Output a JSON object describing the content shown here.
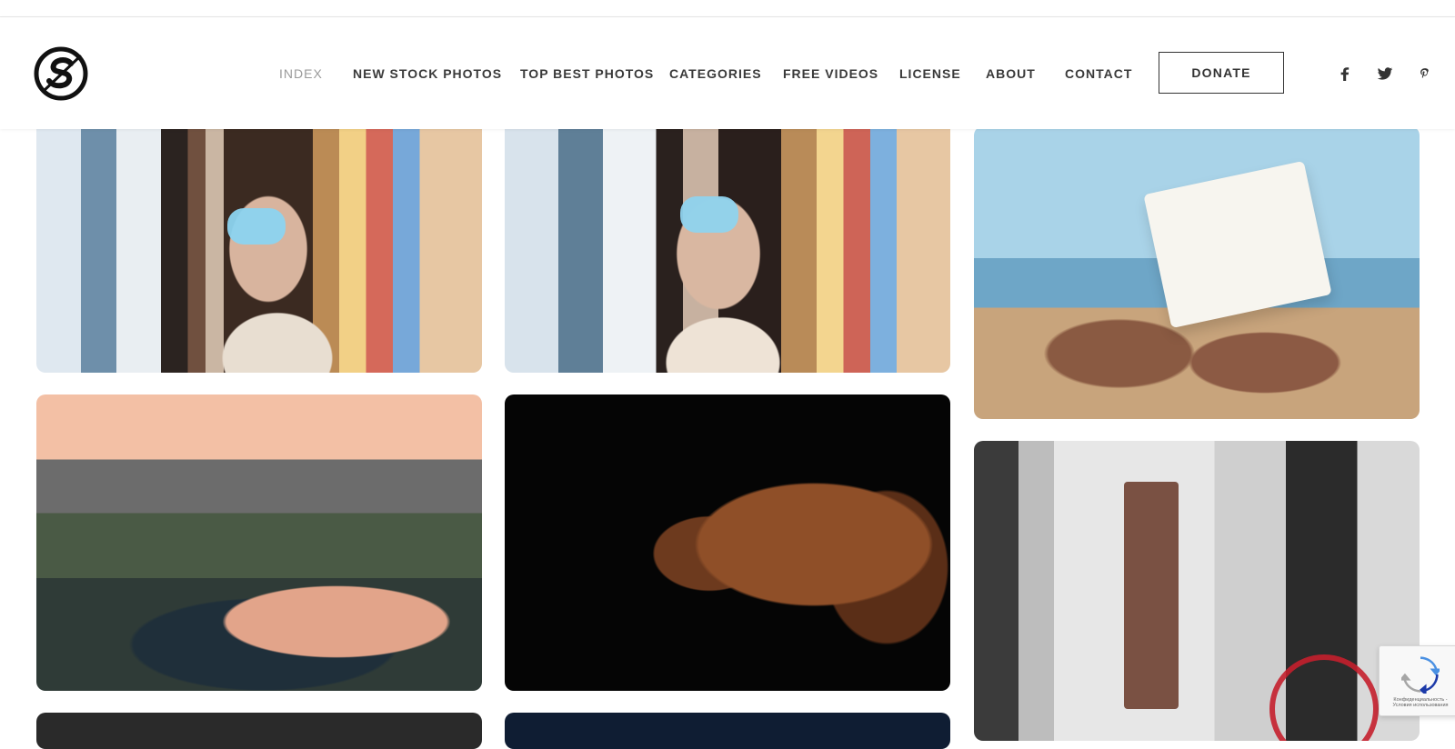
{
  "header": {
    "nav_items": [
      {
        "label": "INDEX",
        "active": true
      },
      {
        "label": "NEW STOCK PHOTOS"
      },
      {
        "label": "TOP BEST PHOTOS"
      },
      {
        "label": "CATEGORIES"
      },
      {
        "label": "FREE VIDEOS"
      },
      {
        "label": "LICENSE"
      },
      {
        "label": "ABOUT"
      },
      {
        "label": "CONTACT"
      }
    ],
    "donate_label": "DONATE",
    "social_icons": [
      "facebook-icon",
      "twitter-icon",
      "pinterest-icon"
    ]
  },
  "gallery": {
    "tiles": [
      {
        "subject": "masked-people-market"
      },
      {
        "subject": "masked-people-market"
      },
      {
        "subject": "reading-book-beach"
      },
      {
        "subject": "mountain-lake"
      },
      {
        "subject": "dachshund-dark-background"
      },
      {
        "subject": "bw-city-bicycle"
      },
      {
        "subject": "dark-photo"
      },
      {
        "subject": "night-photo"
      }
    ]
  },
  "recaptcha": {
    "text": "Конфиденциальность - Условия использования"
  },
  "colors": {
    "text": "#3a3a3a",
    "active_nav": "#9a9a9a",
    "border": "#333333"
  }
}
